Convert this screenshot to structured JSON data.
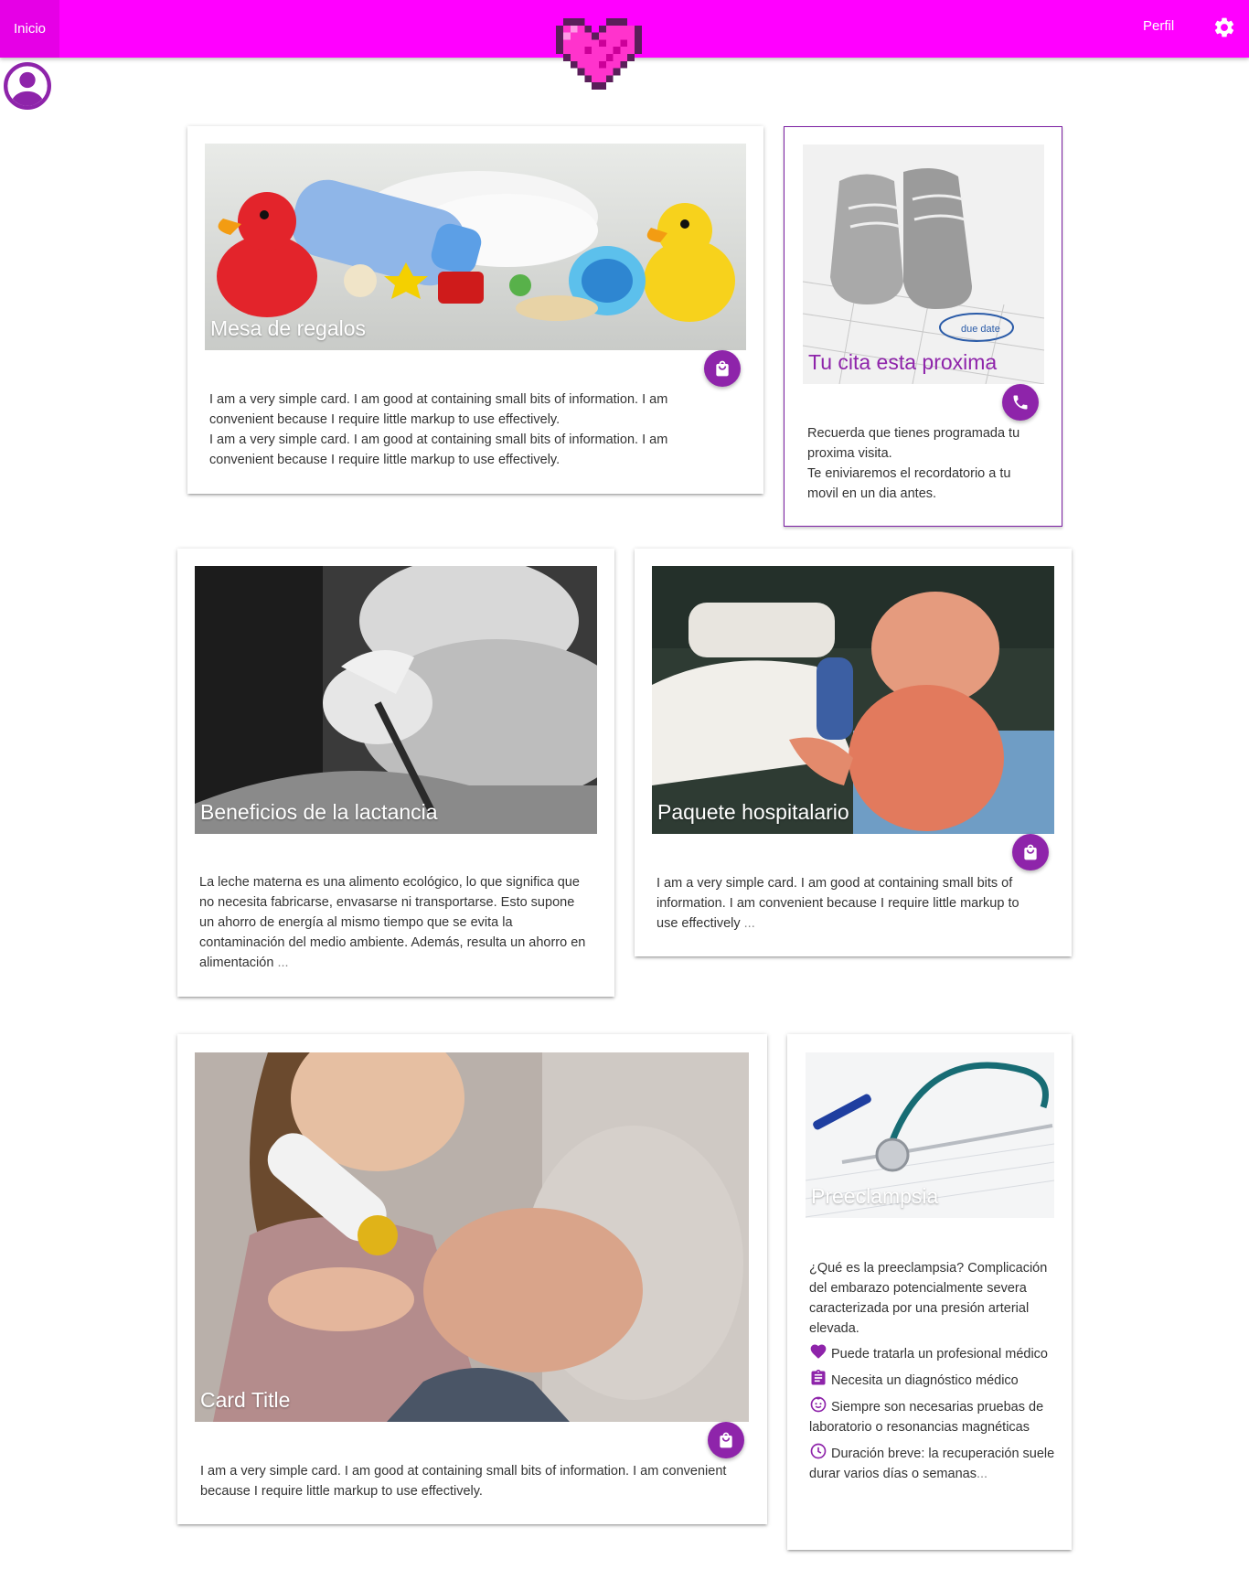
{
  "nav": {
    "home_label": "Inicio",
    "profile_label": "Perfil",
    "brand_color": "#ff00ff",
    "accent_color": "#8e24aa",
    "icons": [
      "pixel-heart-logo",
      "gear-icon",
      "account-circle-icon"
    ]
  },
  "cards": {
    "regalos": {
      "title": "Mesa de regalos",
      "text1": "I am a very simple card. I am good at containing small bits of information. I am convenient because I require little markup to use effectively.",
      "text2": "I am a very simple card. I am good at containing small bits of information. I am convenient because I require little markup to use effectively.",
      "fab_icon": "shopping-bag-icon"
    },
    "cita": {
      "title": "Tu cita esta proxima",
      "text1": "Recuerda que tienes programada tu proxima visita.",
      "text2": "Te eniviaremos el recordatorio a tu movil en un dia antes.",
      "fab_icon": "phone-icon",
      "image_label": "due date"
    },
    "lactancia": {
      "title": "Beneficios de la lactancia",
      "text": "La leche materna es una alimento ecológico, lo que significa que no necesita fabricarse, envasarse ni transportarse. Esto supone un ahorro de energía al mismo tiempo que se evita la contaminación del medio ambiente. Además, resulta un ahorro en alimentación",
      "more": "..."
    },
    "paquete": {
      "title": "Paquete hospitalario",
      "text": "I am a very simple card. I am good at containing small bits of information. I am convenient because I require little markup to use effectively",
      "more": "...",
      "fab_icon": "shopping-bag-icon"
    },
    "card_title": {
      "title": "Card Title",
      "text": "I am a very simple card. I am good at containing small bits of information. I am convenient because I require little markup to use effectively.",
      "fab_icon": "shopping-bag-icon"
    },
    "preeclampsia": {
      "title": "Preeclampsia",
      "intro": "¿Qué es la preeclampsia? Complicación del embarazo potencialmente severa caracterizada por una presión arterial elevada.",
      "items": [
        {
          "icon": "heart-icon",
          "text": "Puede tratarla un profesional médico"
        },
        {
          "icon": "clipboard-icon",
          "text": "Necesita un diagnóstico médico"
        },
        {
          "icon": "baby-face-icon",
          "text": "Siempre son necesarias pruebas de laboratorio o resonancias magnéticas"
        },
        {
          "icon": "clock-icon",
          "text": "Duración breve: la recuperación suele durar varios días o semanas"
        }
      ],
      "more": "..."
    }
  }
}
